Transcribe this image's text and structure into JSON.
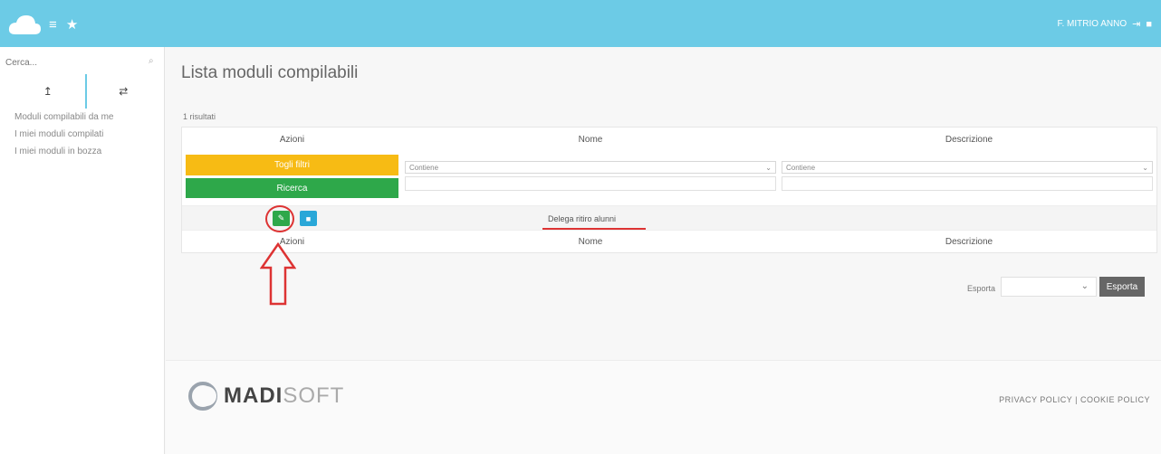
{
  "topbar": {
    "menu_glyphs": "≡ ★",
    "user_label": "F. MITRIO ANNO"
  },
  "sidebar": {
    "search_placeholder": "Cerca...",
    "tab1_glyph": "↥",
    "tab2_glyph": "⇄",
    "items": [
      {
        "label": "Moduli compilabili da me"
      },
      {
        "label": "I miei moduli compilati"
      },
      {
        "label": "I miei moduli in bozza"
      }
    ]
  },
  "main": {
    "title": "Lista moduli compilabili",
    "results_count": "1 risultati",
    "columns": {
      "azioni": "Azioni",
      "nome": "Nome",
      "descrizione": "Descrizione"
    },
    "buttons": {
      "toggle_filters": "Togli filtri",
      "search": "Ricerca"
    },
    "filters": {
      "nome_mode": "Contiene",
      "descrizione_mode": "Contiene"
    },
    "rows": [
      {
        "nome": "Delega ritiro alunni",
        "descrizione": ""
      }
    ],
    "export": {
      "label": "Esporta",
      "button": "Esporta"
    }
  },
  "footer": {
    "logo_bold": "MADI",
    "logo_light": "SOFT",
    "links": "PRIVACY POLICY | COOKIE POLICY"
  },
  "colors": {
    "topbar": "#6ccbe6",
    "yellow": "#f7bb14",
    "green": "#2ea84a",
    "blue": "#29a7d8",
    "annotation_red": "#dd3333"
  }
}
